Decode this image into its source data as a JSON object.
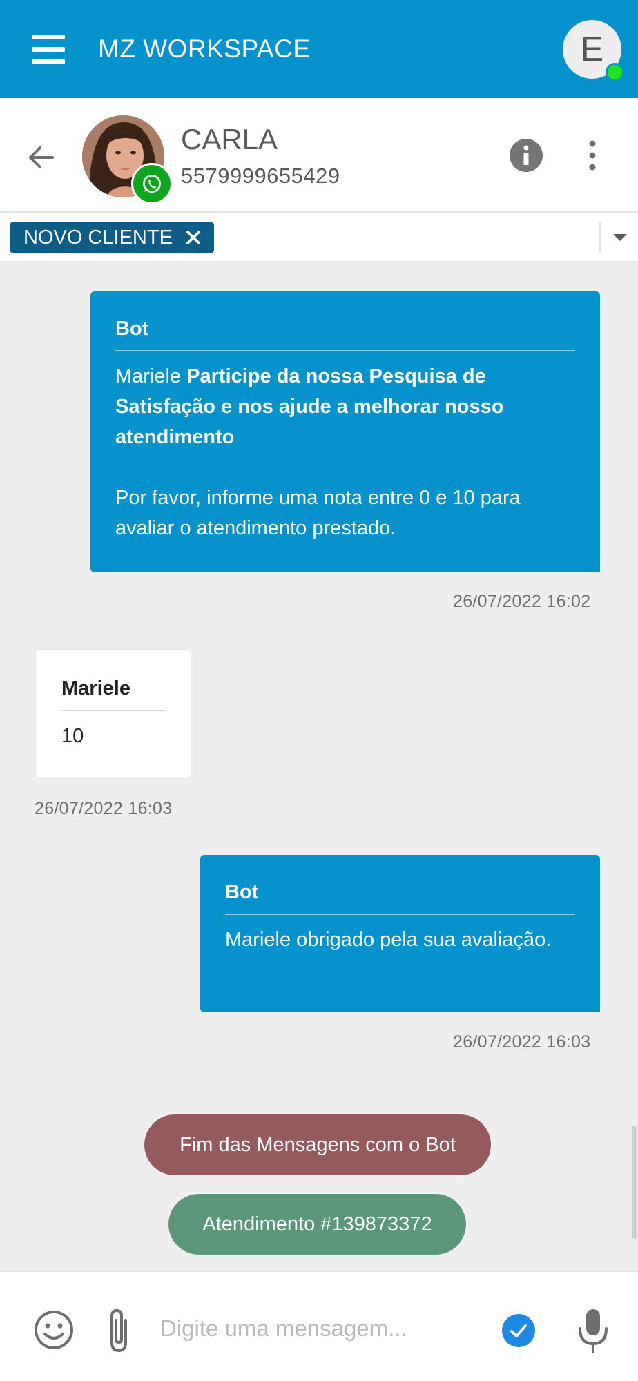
{
  "app": {
    "title": "MZ WORKSPACE",
    "user_initial": "E"
  },
  "contact": {
    "name": "CARLA",
    "phone": "5579999655429"
  },
  "tags": [
    {
      "label": "NOVO CLIENTE"
    }
  ],
  "messages": [
    {
      "direction": "out",
      "sender": "Bot",
      "text_lines": [
        [
          "Mariele ",
          "Participe da nossa Pesquisa de"
        ],
        [
          "",
          "Satisfação e nos ajude a melhorar nosso"
        ],
        [
          "",
          "atendimento"
        ],
        "",
        "Por favor, informe uma nota entre 0 e 10 para",
        "avaliar o atendimento prestado."
      ],
      "timestamp": "26/07/2022 16:02"
    },
    {
      "direction": "in",
      "sender": "Mariele",
      "text": "10",
      "timestamp": "26/07/2022 16:03"
    },
    {
      "direction": "out",
      "sender": "Bot",
      "text": "Mariele obrigado pela sua avaliação.",
      "timestamp": "26/07/2022 16:03"
    }
  ],
  "system_pills": [
    {
      "label": "Fim das Mensagens com o Bot",
      "color": "#955b5c"
    },
    {
      "label": "Atendimento #139873372",
      "color": "#5c977b"
    }
  ],
  "composer": {
    "placeholder": "Digite uma mensagem..."
  },
  "colors": {
    "primary": "#0693cd",
    "tag": "#0d5d86",
    "online": "#1ee41e",
    "whatsapp": "#10a51f"
  },
  "icons": [
    "menu-icon",
    "back-icon",
    "whatsapp-icon",
    "info-icon",
    "more-vert-icon",
    "close-icon",
    "chevron-down-icon",
    "emoji-icon",
    "paperclip-icon",
    "check-circle-icon",
    "mic-icon"
  ]
}
